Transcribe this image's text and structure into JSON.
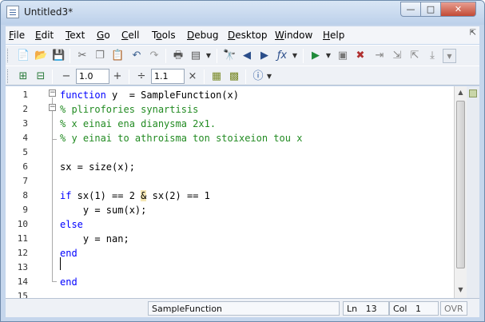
{
  "window": {
    "title": "Untitled3*"
  },
  "menus": [
    "File",
    "Edit",
    "Text",
    "Go",
    "Cell",
    "Tools",
    "Debug",
    "Desktop",
    "Window",
    "Help"
  ],
  "menu_underline_index": [
    0,
    0,
    0,
    0,
    0,
    1,
    0,
    0,
    0,
    0
  ],
  "toolbar": {
    "step_minus": "−",
    "step_value": "1.0",
    "step_plus": "+",
    "divide_symbol": "÷",
    "divide_value": "1.1",
    "times_symbol": "×"
  },
  "editor": {
    "line_numbers": [
      "1",
      "2",
      "3",
      "4",
      "5",
      "6",
      "7",
      "8",
      "9",
      "10",
      "11",
      "12",
      "13",
      "14",
      "15"
    ],
    "lines": [
      [
        {
          "t": "kw",
          "v": "function"
        },
        {
          "t": "plain",
          "v": " y  = SampleFunction(x)"
        }
      ],
      [
        {
          "t": "cm",
          "v": "% plirofories synartisis"
        }
      ],
      [
        {
          "t": "cm",
          "v": "% x einai ena dianysma 2x1."
        }
      ],
      [
        {
          "t": "cm",
          "v": "% y einai to athroisma ton stoixeion tou x"
        }
      ],
      [],
      [
        {
          "t": "plain",
          "v": "sx = size(x);"
        }
      ],
      [],
      [
        {
          "t": "kw",
          "v": "if"
        },
        {
          "t": "plain",
          "v": " sx(1) == 2 "
        },
        {
          "t": "amp",
          "v": "&"
        },
        {
          "t": "plain",
          "v": " sx(2) == 1"
        }
      ],
      [
        {
          "t": "plain",
          "v": "    y = sum(x);"
        }
      ],
      [
        {
          "t": "kw",
          "v": "else"
        }
      ],
      [
        {
          "t": "plain",
          "v": "    y = nan;"
        }
      ],
      [
        {
          "t": "kw",
          "v": "end"
        }
      ],
      [],
      [
        {
          "t": "kw",
          "v": "end"
        }
      ],
      []
    ]
  },
  "status": {
    "function_name": "SampleFunction",
    "ln_label": "Ln",
    "ln_value": "13",
    "col_label": "Col",
    "col_value": "1",
    "mode": "OVR"
  }
}
